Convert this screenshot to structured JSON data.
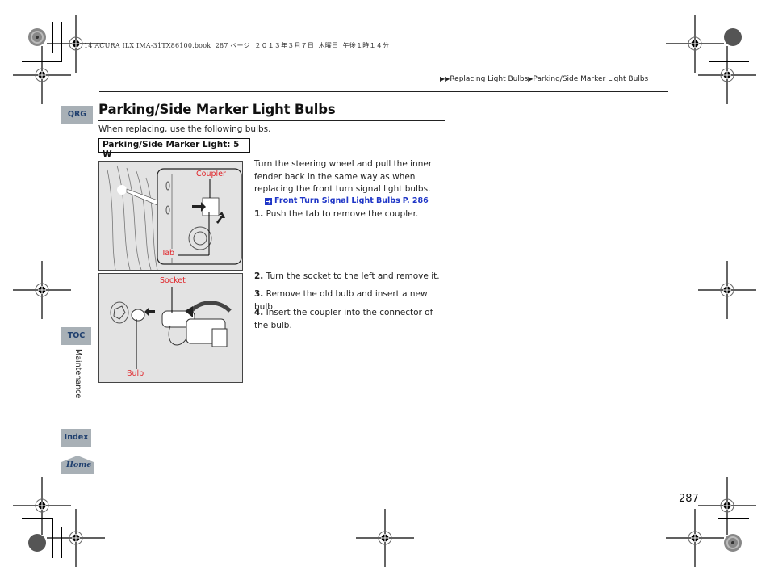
{
  "print_header": {
    "meta_text": "14 ACURA ILX IMA-31TX86100.book  287 ページ  ２０１３年３月７日  木曜日  午後１時１４分"
  },
  "breadcrumb": {
    "arrow_icon": "double-triangle-right-icon",
    "items": [
      "Replacing Light Bulbs",
      "Parking/Side Marker Light Bulbs"
    ]
  },
  "page": {
    "title": "Parking/Side Marker Light Bulbs",
    "intro": "When replacing, use the following bulbs.",
    "spec": "Parking/Side Marker Light: 5 W",
    "number": "287"
  },
  "side_nav": {
    "qrg": "QRG",
    "toc": "TOC",
    "section": "Maintenance",
    "index": "Index",
    "home": "Home"
  },
  "figures": [
    {
      "labels": [
        "Coupler",
        "Tab"
      ]
    },
    {
      "labels": [
        "Socket",
        "Bulb"
      ]
    }
  ],
  "instructions": {
    "lead": "Turn the steering wheel and pull the inner fender back in the same way as when replacing the front turn signal light bulbs.",
    "xref": {
      "icon": "arrow-right-box-icon",
      "title": "Front Turn Signal Light Bulbs",
      "page": "P. 286"
    },
    "steps": [
      {
        "num": "1.",
        "text": "Push the tab to remove the coupler."
      },
      {
        "num": "2.",
        "text": "Turn the socket to the left and remove it."
      },
      {
        "num": "3.",
        "text": "Remove the old bulb and insert a new bulb."
      },
      {
        "num": "4.",
        "text": "Insert the coupler into the connector of the bulb."
      }
    ]
  },
  "colors": {
    "nav_tab_bg": "#a8b0b6",
    "nav_tab_text": "#1f3f6e",
    "link": "#1f36c7",
    "figure_label": "#e0262b",
    "figure_bg": "#e3e3e3"
  }
}
